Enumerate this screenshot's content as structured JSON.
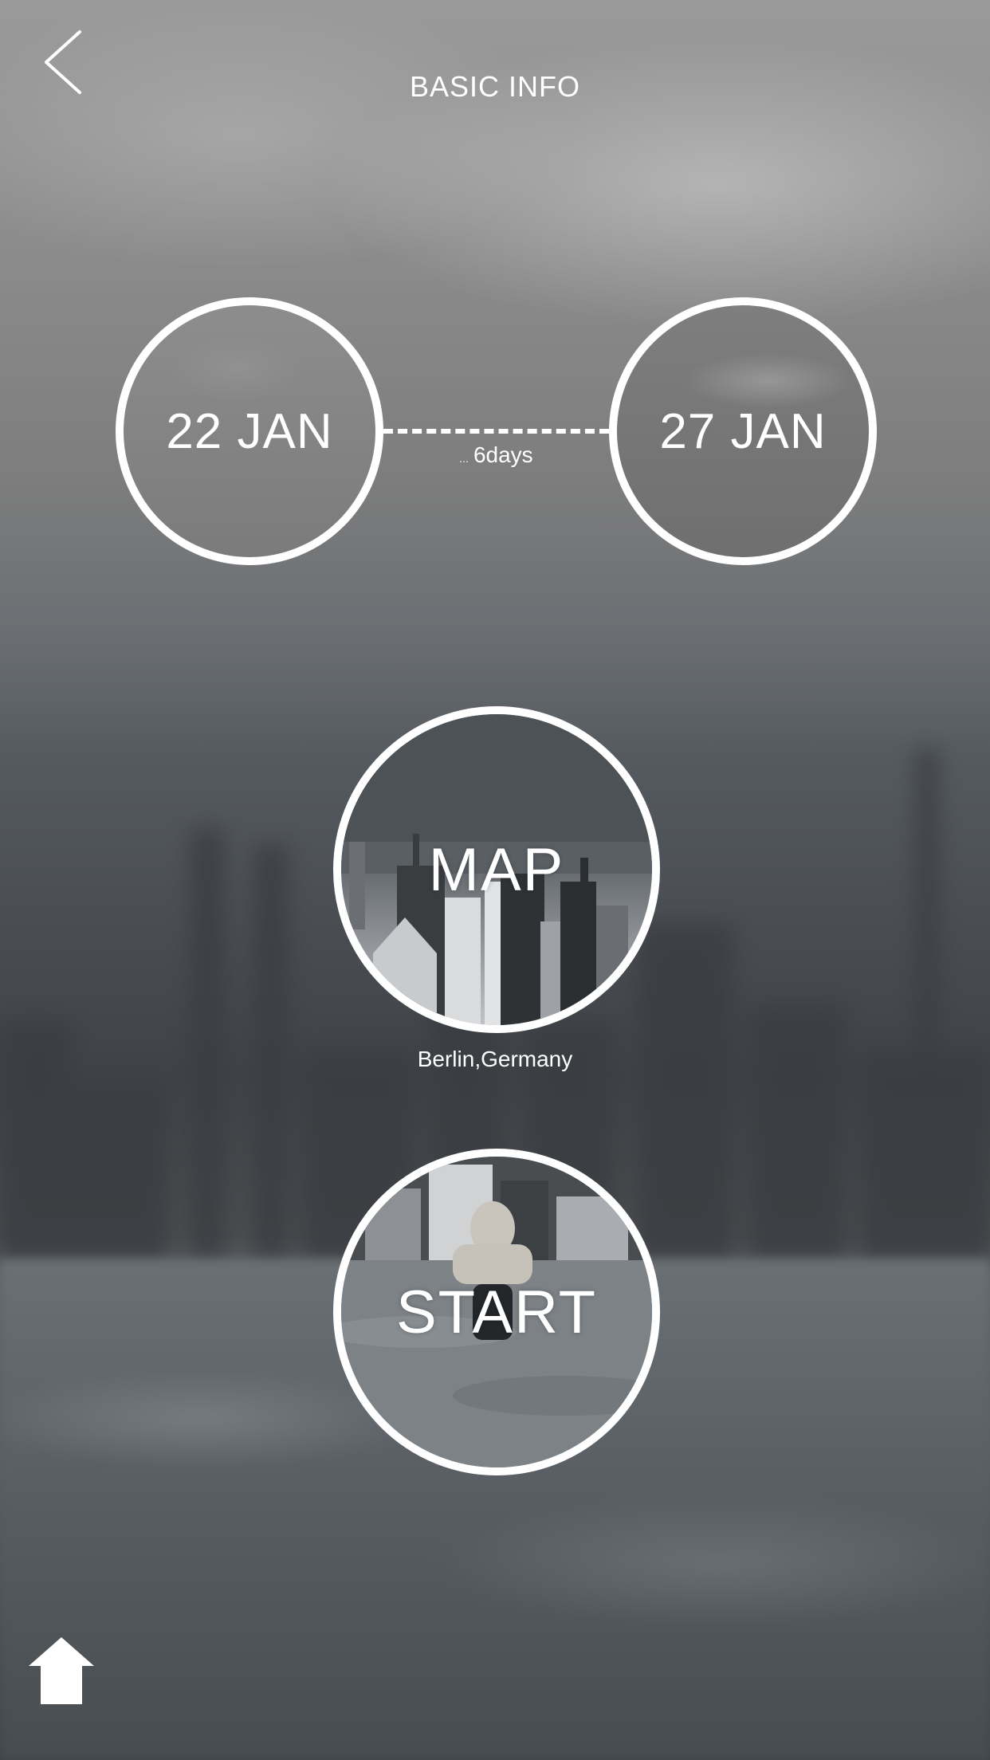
{
  "header": {
    "title": "BASIC INFO",
    "back_icon": "chevron-left-icon"
  },
  "trip": {
    "start_date": "22 JAN",
    "end_date": "27 JAN",
    "duration_dots": "...",
    "duration": "6days"
  },
  "map": {
    "label": "MAP",
    "location": "Berlin,Germany"
  },
  "start": {
    "label": "START"
  },
  "footer": {
    "home_icon": "home-icon"
  },
  "colors": {
    "foreground": "#ffffff",
    "ring": "#ffffff"
  }
}
